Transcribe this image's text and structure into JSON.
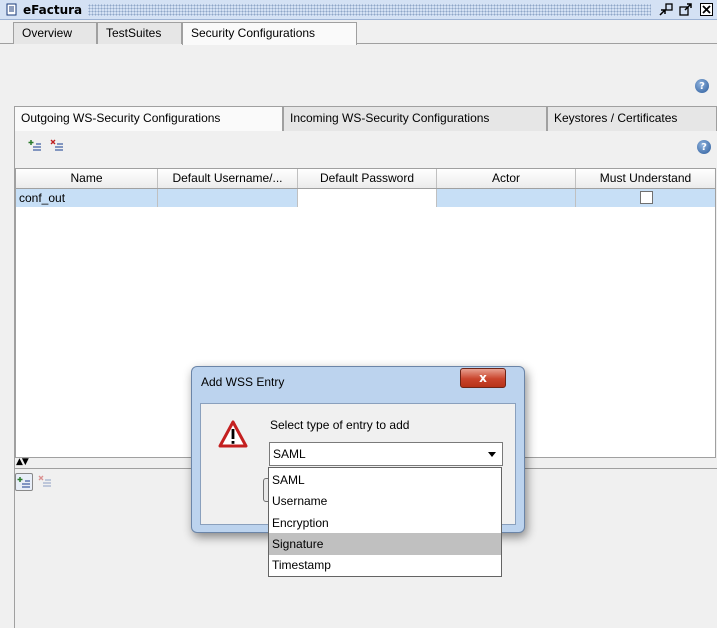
{
  "window": {
    "title": "eFactura"
  },
  "main_tabs": [
    {
      "label": "Overview"
    },
    {
      "label": "TestSuites"
    },
    {
      "label": "Security Configurations",
      "active": true
    }
  ],
  "sub_tabs": [
    {
      "label": "Outgoing WS-Security Configurations",
      "active": true
    },
    {
      "label": "Incoming WS-Security Configurations"
    },
    {
      "label": "Keystores / Certificates"
    }
  ],
  "table": {
    "columns": [
      "Name",
      "Default Username/...",
      "Default Password",
      "Actor",
      "Must Understand"
    ],
    "rows": [
      {
        "name": "conf_out",
        "username": "",
        "password": "",
        "actor": "",
        "must_understand": false
      }
    ]
  },
  "dialog": {
    "title": "Add WSS Entry",
    "close_label": "x",
    "prompt": "Select type of entry to add",
    "selected": "SAML",
    "options": [
      "SAML",
      "Username",
      "Encryption",
      "Signature",
      "Timestamp"
    ],
    "highlighted_option": "Signature"
  },
  "help_glyph": "?",
  "colors": {
    "title_bar": "#d4e1f4",
    "selected_row": "#c7dff6",
    "dialog_frame": "#bcd3ee",
    "close_button": "#c9442c"
  }
}
